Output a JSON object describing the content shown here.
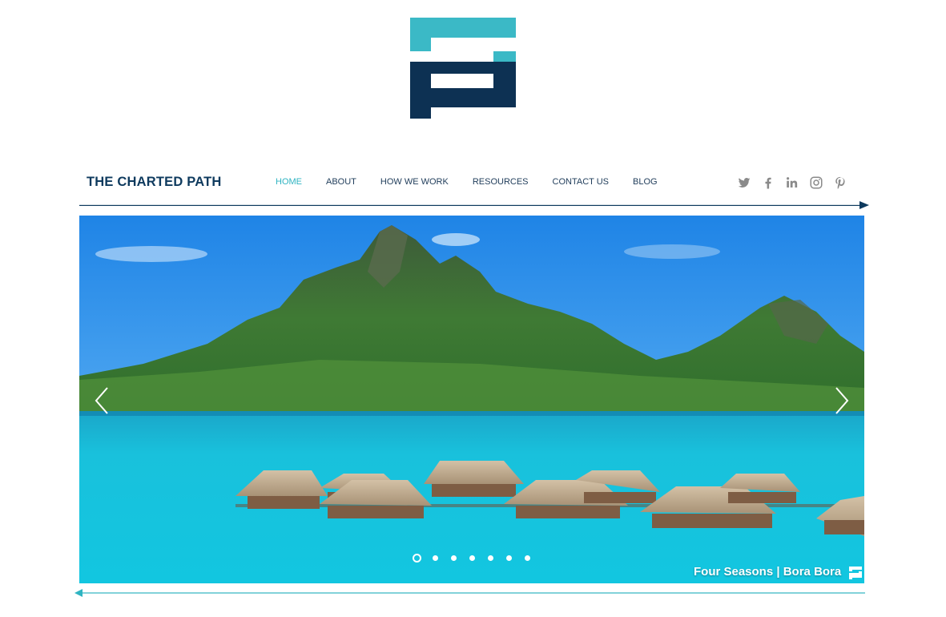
{
  "site": {
    "name": "THE CHARTED PATH"
  },
  "nav": {
    "items": [
      {
        "label": "HOME",
        "active": true
      },
      {
        "label": "ABOUT",
        "active": false
      },
      {
        "label": "HOW WE WORK",
        "active": false
      },
      {
        "label": "RESOURCES",
        "active": false
      },
      {
        "label": "CONTACT US",
        "active": false
      },
      {
        "label": "BLOG",
        "active": false
      }
    ]
  },
  "social": [
    "twitter-icon",
    "facebook-icon",
    "linkedin-icon",
    "instagram-icon",
    "pinterest-icon"
  ],
  "slideshow": {
    "caption": "Four Seasons | Bora Bora",
    "slide_count": 7,
    "active_slide": 1
  },
  "colors": {
    "accent": "#2fb4c2",
    "navy": "#0e3a5e",
    "logo_teal": "#3bb9c6",
    "logo_navy": "#0d3153"
  }
}
